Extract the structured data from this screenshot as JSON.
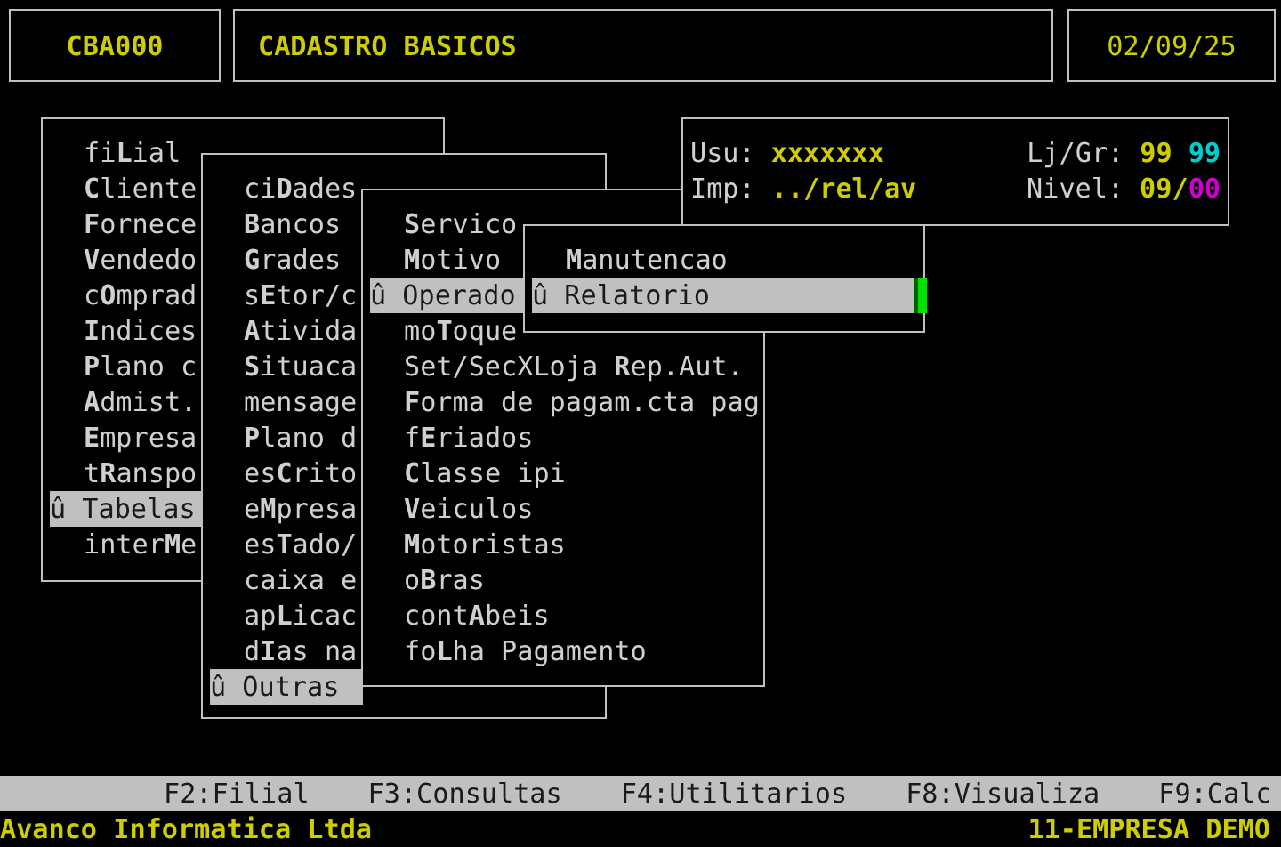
{
  "header": {
    "program_code": "CBA000",
    "title": "CADASTRO BASICOS",
    "date": "02/09/25"
  },
  "info": {
    "rows": [
      {
        "label": "Usu:",
        "values": [
          {
            "text": "xxxxxxx",
            "color": "#cdcd00"
          }
        ],
        "right_label": "Lj/Gr:",
        "right_words": [
          [
            {
              "text": "99",
              "color": "#cdcd00"
            }
          ],
          [
            {
              "text": "99",
              "color": "#00cdcd"
            }
          ]
        ]
      },
      {
        "label": "Imp:",
        "values": [
          {
            "text": "../rel/av",
            "color": "#cdcd00"
          }
        ],
        "right_label": "Nivel:",
        "right_words": [
          [
            {
              "text": "09/",
              "color": "#cdcd00"
            },
            {
              "text": "00",
              "color": "#cd00cd"
            }
          ]
        ]
      }
    ]
  },
  "menus": [
    {
      "items": [
        {
          "label": "fi**L**ial",
          "selected": false
        },
        {
          "label": "**C**liente",
          "selected": false
        },
        {
          "label": "**F**ornece",
          "selected": false
        },
        {
          "label": "**V**endedo",
          "selected": false
        },
        {
          "label": "c**O**mprad",
          "selected": false
        },
        {
          "label": "**I**ndices",
          "selected": false
        },
        {
          "label": "**P**lano c",
          "selected": false
        },
        {
          "label": "**A**dmist.",
          "selected": false
        },
        {
          "label": "**E**mpresa",
          "selected": false
        },
        {
          "label": "t**R**anspo",
          "selected": false
        },
        {
          "label": "û Tabelas",
          "selected": true
        },
        {
          "label": "inter**M**e",
          "selected": false
        }
      ]
    },
    {
      "items": [
        {
          "label": "ci**D**ades",
          "selected": false
        },
        {
          "label": "**B**ancos",
          "selected": false
        },
        {
          "label": "**G**rades",
          "selected": false
        },
        {
          "label": "s**E**tor/c",
          "selected": false
        },
        {
          "label": "**A**tivida",
          "selected": false
        },
        {
          "label": "**S**ituaca",
          "selected": false
        },
        {
          "label": "mensage",
          "selected": false
        },
        {
          "label": "**P**lano d",
          "selected": false
        },
        {
          "label": "es**C**rito",
          "selected": false
        },
        {
          "label": "e**M**presa",
          "selected": false
        },
        {
          "label": "es**T**ado/",
          "selected": false
        },
        {
          "label": "caixa e",
          "selected": false
        },
        {
          "label": "ap**L**icac",
          "selected": false
        },
        {
          "label": "d**I**as na",
          "selected": false
        },
        {
          "label": "û Outras",
          "selected": true
        }
      ]
    },
    {
      "items": [
        {
          "label": "**S**ervico",
          "selected": false
        },
        {
          "label": "**M**otivo",
          "selected": false
        },
        {
          "label": "û Operado",
          "selected": true
        },
        {
          "label": "mo**T**oque",
          "selected": false
        },
        {
          "label": "Set/SecXLoja **R**ep.Aut.",
          "selected": false
        },
        {
          "label": "**F**orma de pagam.cta pag",
          "selected": false
        },
        {
          "label": "f**E**riados",
          "selected": false
        },
        {
          "label": "**C**lasse ipi",
          "selected": false
        },
        {
          "label": "**V**eiculos",
          "selected": false
        },
        {
          "label": "**M**otoristas",
          "selected": false
        },
        {
          "label": "o**B**ras",
          "selected": false
        },
        {
          "label": "cont**A**beis",
          "selected": false
        },
        {
          "label": "fo**L**ha Pagamento",
          "selected": false
        }
      ]
    },
    {
      "items": [
        {
          "label": "**M**anutencao",
          "selected": false,
          "cursor": false
        },
        {
          "label": "û Relatorio",
          "selected": true,
          "cursor": true
        }
      ]
    }
  ],
  "function_keys": [
    "F2:Filial",
    "F3:Consultas",
    "F4:Utilitarios",
    "F8:Visualiza",
    "F9:Calc"
  ],
  "status": {
    "company": "Avanco Informatica Ltda",
    "branch": "11-EMPRESA DEMO"
  }
}
